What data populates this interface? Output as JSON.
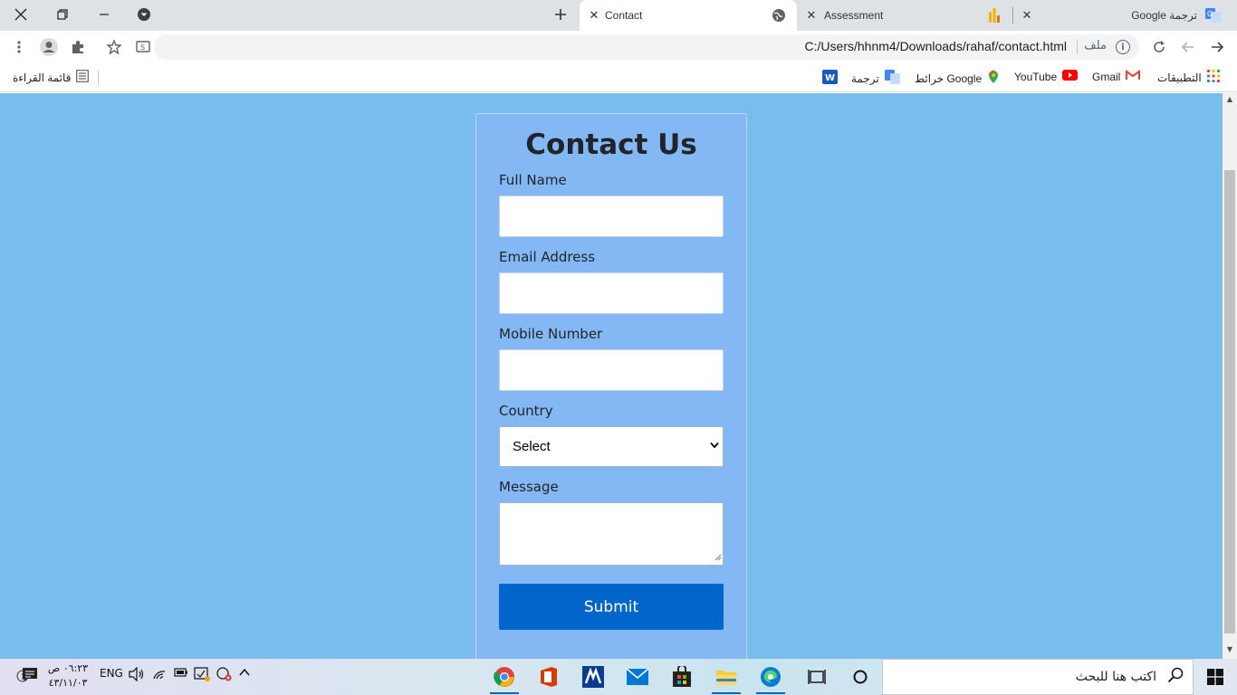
{
  "tabs": [
    {
      "title": "Contact",
      "active": true
    },
    {
      "title": "Assessment",
      "active": false
    },
    {
      "title": "ترجمة Google",
      "active": false
    }
  ],
  "toolbar": {
    "url": "C:/Users/hhnm4/Downloads/rahaf/contact.html",
    "file_label": "ملف"
  },
  "bookmarks": [
    {
      "label": "التطبيقات",
      "icon": "apps-grid-icon"
    },
    {
      "label": "Gmail",
      "icon": "gmail-icon"
    },
    {
      "label": "YouTube",
      "icon": "youtube-icon"
    },
    {
      "label": "خرائط Google",
      "icon": "maps-icon"
    },
    {
      "label": "ترجمة",
      "icon": "translate-icon"
    },
    {
      "label": "",
      "icon": "word-icon"
    }
  ],
  "reading_list": "قائمة القراءة",
  "form": {
    "heading": "Contact Us",
    "fields": {
      "full_name": "Full Name",
      "email": "Email Address",
      "mobile": "Mobile Number",
      "country": "Country",
      "message": "Message"
    },
    "country_selected": "Select",
    "submit": "Submit"
  },
  "taskbar": {
    "search_placeholder": "اكتب هنا للبحث",
    "language": "ENG",
    "time": "٠٦:٢٣ ص",
    "date": "٤٣/١١/٠٣",
    "notification_count": "1"
  },
  "colors": {
    "page_bg": "#79bcee",
    "card_bg": "#84b8f5",
    "submit_bg": "#0066cc"
  }
}
